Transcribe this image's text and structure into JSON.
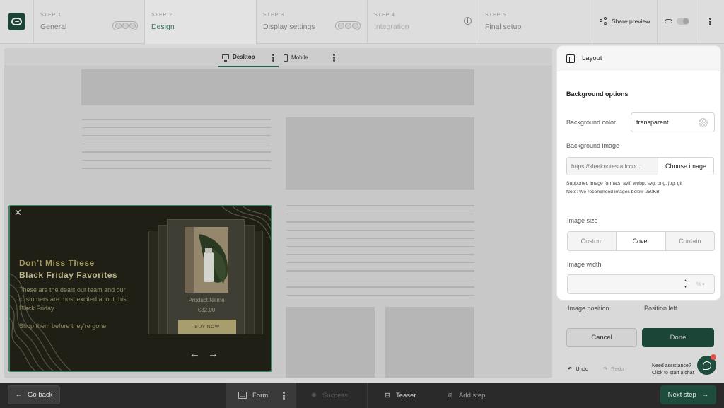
{
  "steps": [
    {
      "num": "STEP 1",
      "title": "General"
    },
    {
      "num": "STEP 2",
      "title": "Design"
    },
    {
      "num": "STEP 3",
      "title": "Display settings"
    },
    {
      "num": "STEP 4",
      "title": "Integration"
    },
    {
      "num": "STEP 5",
      "title": "Final setup"
    }
  ],
  "header": {
    "share_label": "Share preview"
  },
  "device_tabs": {
    "desktop": "Desktop",
    "mobile": "Mobile"
  },
  "popup": {
    "headline_1": "Don’t Miss These",
    "headline_2": "Black Friday Favorites",
    "body_1": "These are the deals our team and our customers are most excited about this Black Friday.",
    "body_2": "Shop them before they're gone.",
    "product_name": "Product Name",
    "product_price": "€32.00",
    "buy_label": "BUY NOW",
    "close": "✕",
    "prev": "←",
    "next": "→"
  },
  "panel": {
    "title": "Layout",
    "section": "Background options",
    "bg_color_label": "Background color",
    "bg_color_value": "transparent",
    "bg_image_label": "Background image",
    "bg_image_placeholder": "https://sleeknotestaticco...",
    "choose_image": "Choose image",
    "note_1": "Supported image formats: avif, webp, svg, png, jpg, gif",
    "note_2": "Note: We recommend images below 250KB",
    "image_size_label": "Image size",
    "size_options": [
      "Custom",
      "Cover",
      "Contain"
    ],
    "size_selected": "Cover",
    "image_width_label": "Image width",
    "width_value": "",
    "width_unit": "%"
  },
  "under_panel": {
    "image_position": "Image position",
    "position_left": "Position left",
    "cancel": "Cancel",
    "done": "Done",
    "undo": "Undo",
    "redo": "Redo",
    "assist_1": "Need assistance?",
    "assist_2": "Click to start a chat"
  },
  "bottom": {
    "go_back": "Go back",
    "tabs": [
      "Form",
      "Success",
      "Teaser",
      "Add step"
    ],
    "next_step": "Next step"
  },
  "colors": {
    "brand": "#1e4d3d",
    "accent_green": "#3d7b66",
    "popup_bg": "#232318",
    "popup_gold": "#b7a96c"
  }
}
